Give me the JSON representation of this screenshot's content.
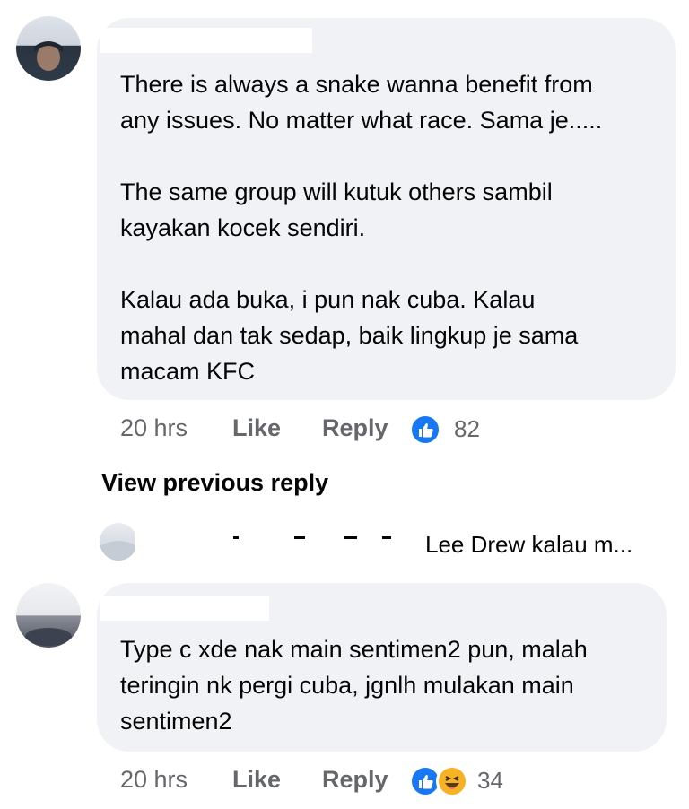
{
  "comments": [
    {
      "text": "There is always a snake wanna benefit from\nany issues. No matter what race. Sama je.....\n\nThe same group will kutuk others sambil\nkayakan kocek sendiri.\n\nKalau ada buka, i pun nak cuba. Kalau\nmahal dan tak sedap, baik lingkup je sama\nmacam KFC",
      "time": "20 hrs",
      "like_label": "Like",
      "reply_label": "Reply",
      "reaction_count": "82"
    },
    {
      "text": "Type c xde nak main sentimen2 pun, malah\nteringin nk pergi cuba, jgnlh mulakan main\nsentimen2",
      "time": "20 hrs",
      "like_label": "Like",
      "reply_label": "Reply",
      "reaction_count": "34"
    }
  ],
  "view_previous_reply": "View previous reply",
  "reply_preview": "Lee Drew kalau m...",
  "colors": {
    "bubble": "#f0f2f5",
    "meta": "#65676b",
    "like_blue": "#1877f2",
    "haha_yellow": "#f7b125"
  },
  "icons": [
    "thumbs-up-icon",
    "haha-emoji-icon"
  ]
}
